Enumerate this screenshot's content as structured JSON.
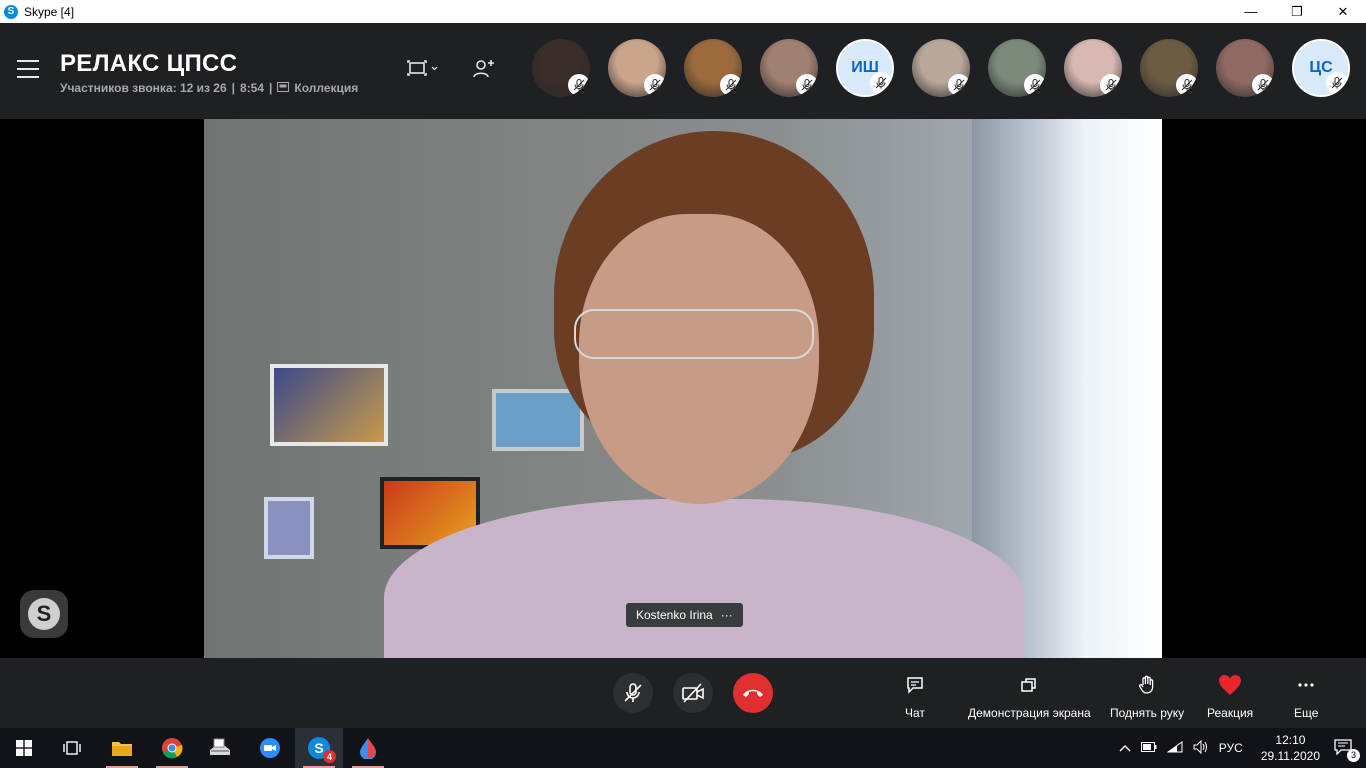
{
  "window": {
    "title": "Skype [4]",
    "controls": {
      "minimize": "—",
      "maximize": "❐",
      "close": "✕"
    }
  },
  "header": {
    "call_title": "РЕЛАКС ЦПСС",
    "participants_text": "Участников звонка: 12 из 26",
    "separator": "|",
    "duration": "8:54",
    "collection_label": "Коллекция"
  },
  "participants": [
    {
      "type": "photo",
      "color": "#3a2d2a",
      "muted": true
    },
    {
      "type": "photo",
      "color": "#c9a58c",
      "muted": true
    },
    {
      "type": "photo",
      "color": "#9a6a3c",
      "muted": true
    },
    {
      "type": "photo",
      "color": "#a08070",
      "muted": true
    },
    {
      "type": "initials",
      "initials": "ИШ",
      "muted": true
    },
    {
      "type": "photo",
      "color": "#b8a89a",
      "muted": true
    },
    {
      "type": "photo",
      "color": "#7b8a7a",
      "muted": true
    },
    {
      "type": "photo",
      "color": "#d7b8b2",
      "muted": true
    },
    {
      "type": "photo",
      "color": "#6b5c43",
      "muted": true
    },
    {
      "type": "photo",
      "color": "#8e6a62",
      "muted": true
    },
    {
      "type": "initials",
      "initials": "ЦС",
      "muted": true
    }
  ],
  "video": {
    "speaker_name": "Kostenko Irina",
    "more": "···"
  },
  "actions": [
    {
      "name": "chat",
      "label": "Чат"
    },
    {
      "name": "share-screen",
      "label": "Демонстрация экрана"
    },
    {
      "name": "raise-hand",
      "label": "Поднять руку"
    },
    {
      "name": "reaction",
      "label": "Реакция"
    },
    {
      "name": "more",
      "label": "Еще"
    }
  ],
  "taskbar": {
    "skype_badge": "4",
    "language": "РУС",
    "time": "12:10",
    "date": "29.11.2020",
    "notifications": "3"
  },
  "colors": {
    "accent": "#0a8ae0",
    "end_call": "#e02f2f",
    "header_bg": "#1f2023",
    "reaction": "#e8262c"
  }
}
